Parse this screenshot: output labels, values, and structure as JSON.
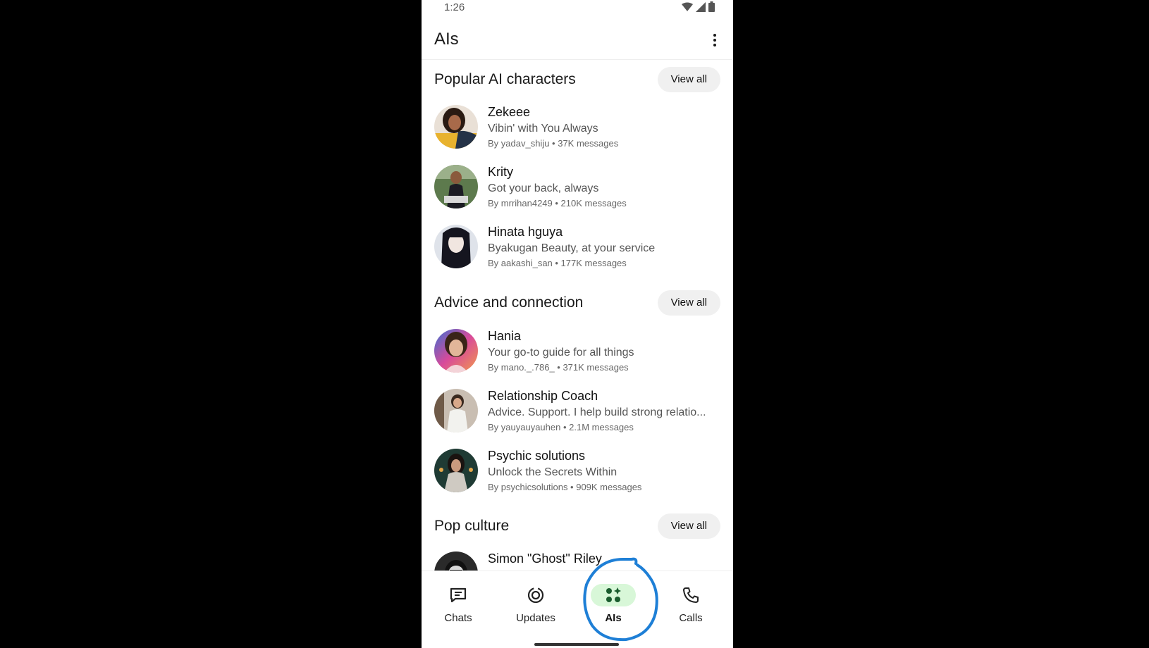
{
  "status": {
    "time": "1:26"
  },
  "header": {
    "title": "AIs"
  },
  "sections": [
    {
      "title": "Popular AI characters",
      "view_all": "View all",
      "items": [
        {
          "name": "Zekeee",
          "description": "Vibin' with You Always",
          "meta": "By yadav_shiju • 37K messages"
        },
        {
          "name": "Krity",
          "description": "Got your back, always",
          "meta": "By mrrihan4249 • 210K messages"
        },
        {
          "name": "Hinata hguya",
          "description": "Byakugan Beauty, at your service",
          "meta": "By aakashi_san • 177K messages"
        }
      ]
    },
    {
      "title": "Advice and connection",
      "view_all": "View all",
      "items": [
        {
          "name": "Hania",
          "description": "Your go-to guide for all things",
          "meta": "By mano._.786_ • 371K messages"
        },
        {
          "name": " Relationship Coach",
          "description": "Advice. Support. I help build strong relatio...",
          "meta": "By yauyauyauhen • 2.1M messages"
        },
        {
          "name": "Psychic solutions",
          "description": "Unlock the Secrets Within",
          "meta": "By psychicsolutions • 909K messages"
        }
      ]
    },
    {
      "title": "Pop culture",
      "view_all": "View all",
      "items": [
        {
          "name": "Simon \"Ghost\" Riley"
        }
      ]
    }
  ],
  "nav": [
    {
      "label": "Chats",
      "icon": "chats-icon"
    },
    {
      "label": "Updates",
      "icon": "updates-icon"
    },
    {
      "label": "AIs",
      "icon": "ais-icon",
      "active": true
    },
    {
      "label": "Calls",
      "icon": "calls-icon"
    }
  ],
  "colors": {
    "accent": "#1a8c3a",
    "active_pill": "#d8f7d8",
    "highlight": "#1e7fd6"
  }
}
